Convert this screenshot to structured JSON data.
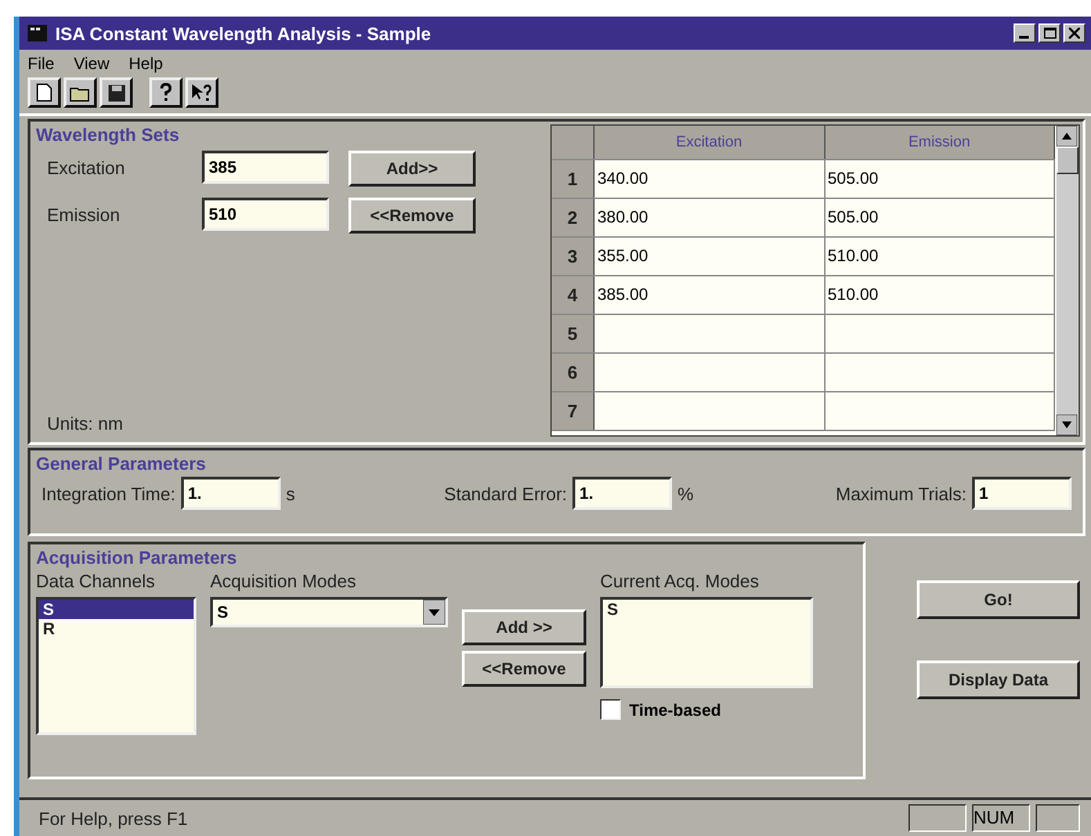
{
  "window": {
    "title": "ISA Constant Wavelength Analysis - Sample"
  },
  "menu": [
    "File",
    "View",
    "Help"
  ],
  "wavelength_sets": {
    "title": "Wavelength Sets",
    "fields": [
      {
        "label": "Excitation",
        "value": "385"
      },
      {
        "label": "Emission",
        "value": "510"
      }
    ],
    "buttons": [
      "Add>>",
      "<<Remove"
    ],
    "units": "Units:  nm",
    "table": {
      "columns": [
        "Excitation",
        "Emission"
      ],
      "rows": [
        {
          "number": "1",
          "cells": [
            "340.00",
            "505.00"
          ]
        },
        {
          "number": "2",
          "cells": [
            "380.00",
            "505.00"
          ]
        },
        {
          "number": "3",
          "cells": [
            "355.00",
            "510.00"
          ]
        },
        {
          "number": "4",
          "cells": [
            "385.00",
            "510.00"
          ]
        },
        {
          "number": "5",
          "cells": []
        },
        {
          "number": "6",
          "cells": []
        },
        {
          "number": "7",
          "cells": []
        }
      ]
    }
  },
  "general_parameters": {
    "title": "General Parameters",
    "fields": [
      {
        "label": "Integration Time:",
        "value": "1.",
        "unit": "s"
      },
      {
        "label": "Standard Error:",
        "value": "1.",
        "unit": "%"
      },
      {
        "label": "Maximum Trials:",
        "value": "1"
      }
    ]
  },
  "acquisition_parameters": {
    "title": "Acquisition Parameters",
    "data_channels": {
      "label": "Data Channels",
      "items": [
        {
          "label": "S",
          "selected": true
        },
        {
          "label": "R",
          "selected": false
        }
      ]
    },
    "acquisition_modes": {
      "label": "Acquisition Modes",
      "value": "S"
    },
    "buttons": [
      "Add >>",
      "<<Remove"
    ],
    "current_modes": {
      "label": "Current Acq. Modes",
      "items": [
        "S"
      ]
    },
    "time_based": {
      "label": "Time-based",
      "checked": false
    }
  },
  "side_buttons": [
    "Go!",
    "Display Data"
  ],
  "status_bar": {
    "text": "For Help, press F1",
    "indicator": "NUM"
  }
}
